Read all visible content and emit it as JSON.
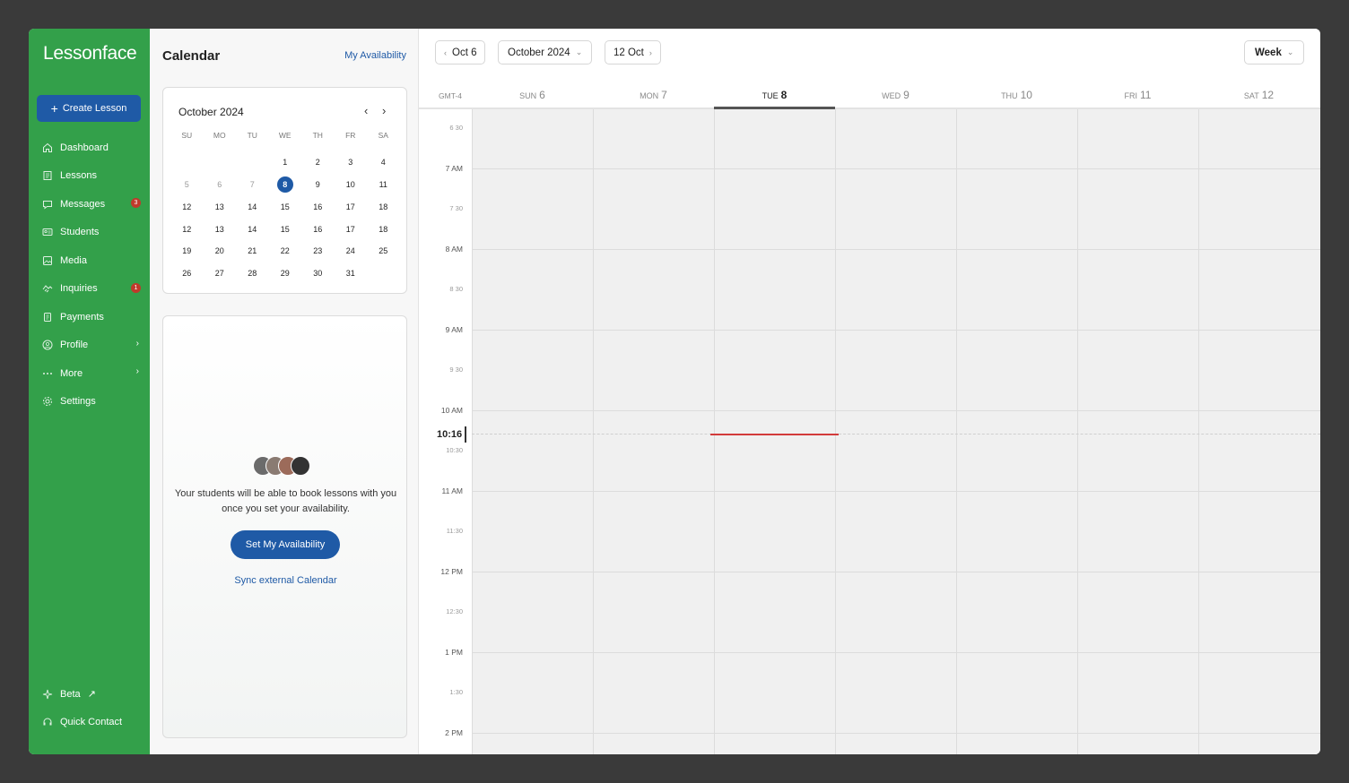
{
  "app": {
    "logo": "Lessonface"
  },
  "sidebar": {
    "create_label": "Create Lesson",
    "items": [
      {
        "label": "Dashboard",
        "icon": "home-icon",
        "badge": ""
      },
      {
        "label": "Lessons",
        "icon": "book-icon",
        "badge": ""
      },
      {
        "label": "Messages",
        "icon": "chat-icon",
        "badge": "3"
      },
      {
        "label": "Students",
        "icon": "id-card-icon",
        "badge": ""
      },
      {
        "label": "Media",
        "icon": "media-icon",
        "badge": ""
      },
      {
        "label": "Inquiries",
        "icon": "handshake-icon",
        "badge": "1"
      },
      {
        "label": "Payments",
        "icon": "receipt-icon",
        "badge": ""
      },
      {
        "label": "Profile",
        "icon": "user-circle-icon",
        "badge": ""
      },
      {
        "label": "More",
        "icon": "dots-icon",
        "badge": ""
      },
      {
        "label": "Settings",
        "icon": "gear-icon",
        "badge": ""
      }
    ],
    "bottom": [
      {
        "label": "Beta",
        "icon": "sparkle-icon"
      },
      {
        "label": "Quick Contact",
        "icon": "headset-icon"
      }
    ]
  },
  "panel": {
    "title": "Calendar",
    "my_availability": "My Availability",
    "mini_calendar": {
      "month": "October 2024",
      "weekdays": [
        "SU",
        "MO",
        "TU",
        "WE",
        "TH",
        "FR",
        "SA"
      ],
      "rows": [
        [
          "",
          "",
          "",
          "1",
          "2",
          "3",
          "4"
        ],
        [
          "5",
          "6",
          "7",
          "8",
          "9",
          "10",
          "11"
        ],
        [
          "12",
          "13",
          "14",
          "15",
          "16",
          "17",
          "18"
        ],
        [
          "12",
          "13",
          "14",
          "15",
          "16",
          "17",
          "18"
        ],
        [
          "19",
          "20",
          "21",
          "22",
          "23",
          "24",
          "25"
        ],
        [
          "26",
          "27",
          "28",
          "29",
          "30",
          "31",
          ""
        ]
      ],
      "selected": "8"
    },
    "availability_text": "Your students will be able to book lessons with you once you set your availability.",
    "set_button": "Set My Availability",
    "sync_link": "Sync external Calendar"
  },
  "toolbar": {
    "prev_label": "Oct 6",
    "month_label": "October 2024",
    "next_label": "12 Oct",
    "view_label": "Week"
  },
  "week": {
    "timezone": "GMT-4",
    "days": [
      {
        "dow": "SUN",
        "num": "6"
      },
      {
        "dow": "MON",
        "num": "7"
      },
      {
        "dow": "TUE",
        "num": "8"
      },
      {
        "dow": "WED",
        "num": "9"
      },
      {
        "dow": "THU",
        "num": "10"
      },
      {
        "dow": "FRI",
        "num": "11"
      },
      {
        "dow": "SAT",
        "num": "12"
      }
    ],
    "today_index": 2,
    "time_labels": [
      "6 30",
      "7 AM",
      "7 30",
      "8 AM",
      "8 30",
      "9 AM",
      "9 30",
      "10 AM",
      "10:30",
      "11 AM",
      "11:30",
      "12 PM",
      "12:30",
      "1 PM",
      "1:30",
      "2 PM"
    ],
    "now_label": "10:16"
  },
  "colors": {
    "sidebar": "#33a04a",
    "accent": "#1f5aa6",
    "now_line": "#d23b3b",
    "badge": "#c0392b"
  }
}
